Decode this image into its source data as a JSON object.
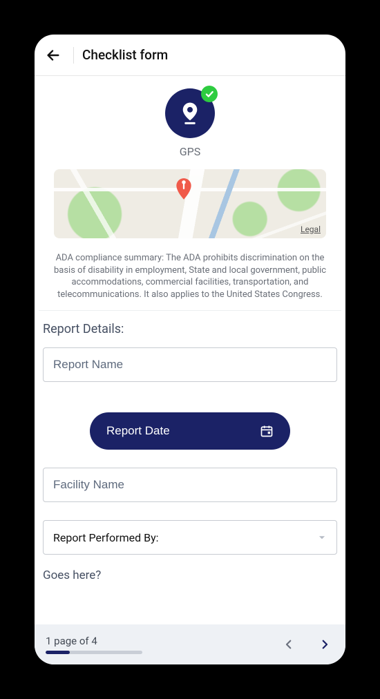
{
  "header": {
    "title": "Checklist form"
  },
  "gps": {
    "label": "GPS"
  },
  "map": {
    "legal": "Legal"
  },
  "summary": "ADA compliance summary:  The ADA prohibits discrimination on the basis of disability in employment,  State and local government, public accommodations, commercial facilities,  transportation, and telecommunications.  It also applies to the United States Congress.",
  "form": {
    "section_title": "Report Details:",
    "report_name_placeholder": "Report Name",
    "report_name_value": "",
    "report_date_label": "Report Date",
    "facility_name_placeholder": "Facility Name",
    "facility_name_value": "",
    "performed_by_label": "Report Performed By:",
    "goes_here": "Goes here?"
  },
  "pager": {
    "label": "1 page of 4",
    "current": 1,
    "total": 4,
    "progress_percent": 25
  },
  "colors": {
    "primary": "#1b2266",
    "success": "#2ecc40",
    "muted_text": "#6a6f78",
    "border": "#c7cbd1",
    "footer_bg": "#eef1f5"
  },
  "icons": {
    "back": "back-arrow-icon",
    "pin": "map-pin-icon",
    "check": "check-icon",
    "calendar": "calendar-icon",
    "caret": "chevron-down-icon",
    "prev": "chevron-left-icon",
    "next": "chevron-right-icon"
  }
}
